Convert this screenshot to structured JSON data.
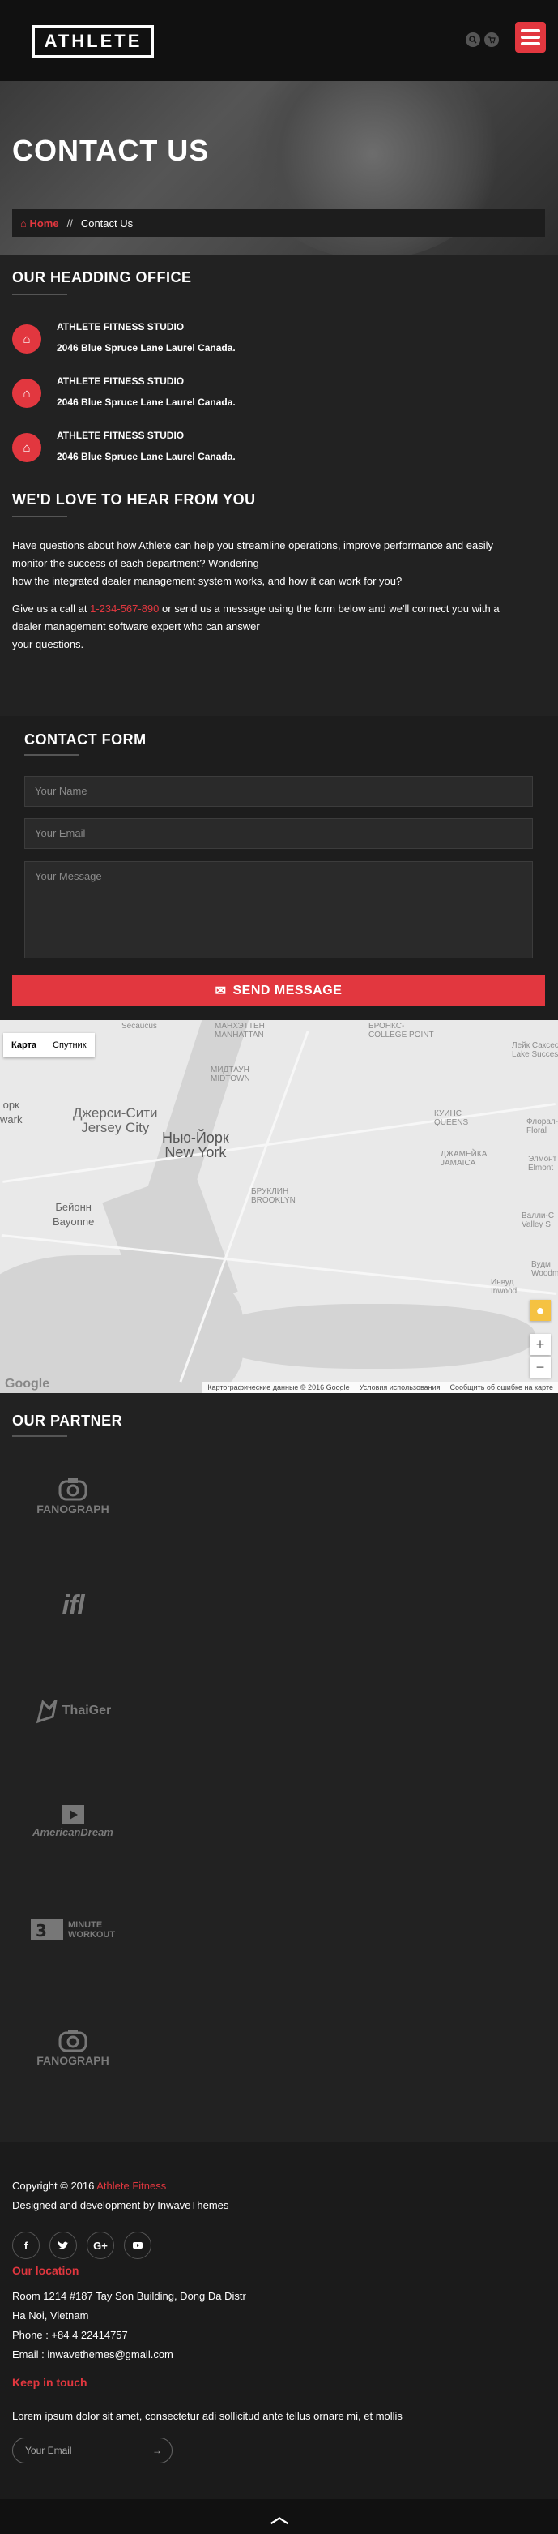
{
  "header": {
    "logo": "ATHLETE",
    "search_icon": "search-icon",
    "cart_icon": "cart-icon",
    "menu_icon": "hamburger-icon"
  },
  "banner": {
    "title": "CONTACT US",
    "breadcrumb": {
      "home": "Home",
      "separator": "//",
      "current": "Contact Us"
    }
  },
  "office": {
    "heading": "OUR HEADDING OFFICE",
    "items": [
      {
        "name": "ATHLETE FITNESS STUDIO",
        "address": "2046 Blue Spruce Lane Laurel Canada."
      },
      {
        "name": "ATHLETE FITNESS STUDIO",
        "address": "2046 Blue Spruce Lane Laurel Canada."
      },
      {
        "name": "ATHLETE FITNESS STUDIO",
        "address": "2046 Blue Spruce Lane Laurel Canada."
      }
    ]
  },
  "hear": {
    "heading": "WE'D LOVE TO HEAR FROM YOU",
    "p1_line1": "Have questions about how Athlete can help you streamline operations, improve performance and easily",
    "p1_line2": "monitor the success of each department? Wondering",
    "p1_line3": "how the integrated dealer management system works, and how it can work for you?",
    "p2_before": "Give us a call at ",
    "phone": "1-234-567-890",
    "p2_after": " or send us a message using the form below and we'll connect you with a",
    "p2_line2": "dealer management software expert who can answer",
    "p2_line3": "your questions."
  },
  "form": {
    "heading": "CONTACT FORM",
    "name_placeholder": "Your Name",
    "email_placeholder": "Your Email",
    "message_placeholder": "Your Message",
    "send_label": "SEND MESSAGE"
  },
  "map": {
    "type_map": "Карта",
    "type_satellite": "Спутник",
    "labels": {
      "secaucus": "Secaucus",
      "manhattan": "МАНХЭТТЕН\nMANHATTAN",
      "midtown": "МИДТАУН\nMIDTOWN",
      "bronx_cp": "БРОНКС-\nCOLLEGE POINT",
      "jersey_city": "Джерси-Сити\nJersey City",
      "new_york": "Нью-Йорк\nNew York",
      "brooklyn": "БРУКЛИН\nBROOKLYN",
      "bayonne": "Бейонн\nBayonne",
      "queens": "КУИНС\nQUEENS",
      "jamaica": "ДЖАМЕЙКА\nJAMAICA",
      "lake_success": "Лейк Саксесс\nLake Success",
      "floral": "Флорал-\nFloral",
      "elmont": "Элмонт\nElmont",
      "valley": "Валли-С\nValley S",
      "woodm": "Вудм\nWoodm",
      "inwood": "Инвуд\nInwood",
      "ork": "орк\nwark"
    },
    "footer_data": "Картографические данные © 2016 Google",
    "footer_terms": "Условия использования",
    "footer_report": "Сообщить об ошибке на карте",
    "google": "Google"
  },
  "partners": {
    "heading": "OUR PARTNER",
    "items": [
      {
        "name": "FANOGRAPH",
        "icon": "camera-icon"
      },
      {
        "name": "ifl",
        "icon": "ifl-logo-icon"
      },
      {
        "name": "ThaiGer",
        "icon": "tiger-icon"
      },
      {
        "name": "AmericanDream",
        "icon": "play-icon"
      },
      {
        "name": "MINUTE WORKOUT",
        "icon": "runner-icon"
      },
      {
        "name": "FANOGRAPH",
        "icon": "camera-icon"
      }
    ]
  },
  "footer": {
    "copyright_before": "Copyright © 2016 ",
    "brand": "Athlete Fitness",
    "designed": "Designed and development by InwaveThemes",
    "social": [
      "f",
      "t",
      "G+",
      "yt"
    ],
    "location_heading": "Our location",
    "address1": "Room 1214  #187 Tay Son Building, Dong Da Distr",
    "address2": "Ha Noi, Vietnam",
    "phone": "Phone : +84 4 22414757",
    "email": "Email : inwavethemes@gmail.com",
    "keep_heading": "Keep in touch",
    "keep_text": "Lorem ipsum dolor sit amet, consectetur adi sollicitud ante tellus ornare mi, et mollis",
    "email_placeholder": "Your Email",
    "to_top": "︿"
  },
  "colors": {
    "accent": "#e2373f",
    "dark": "#222222",
    "darker": "#1b1b1b"
  }
}
